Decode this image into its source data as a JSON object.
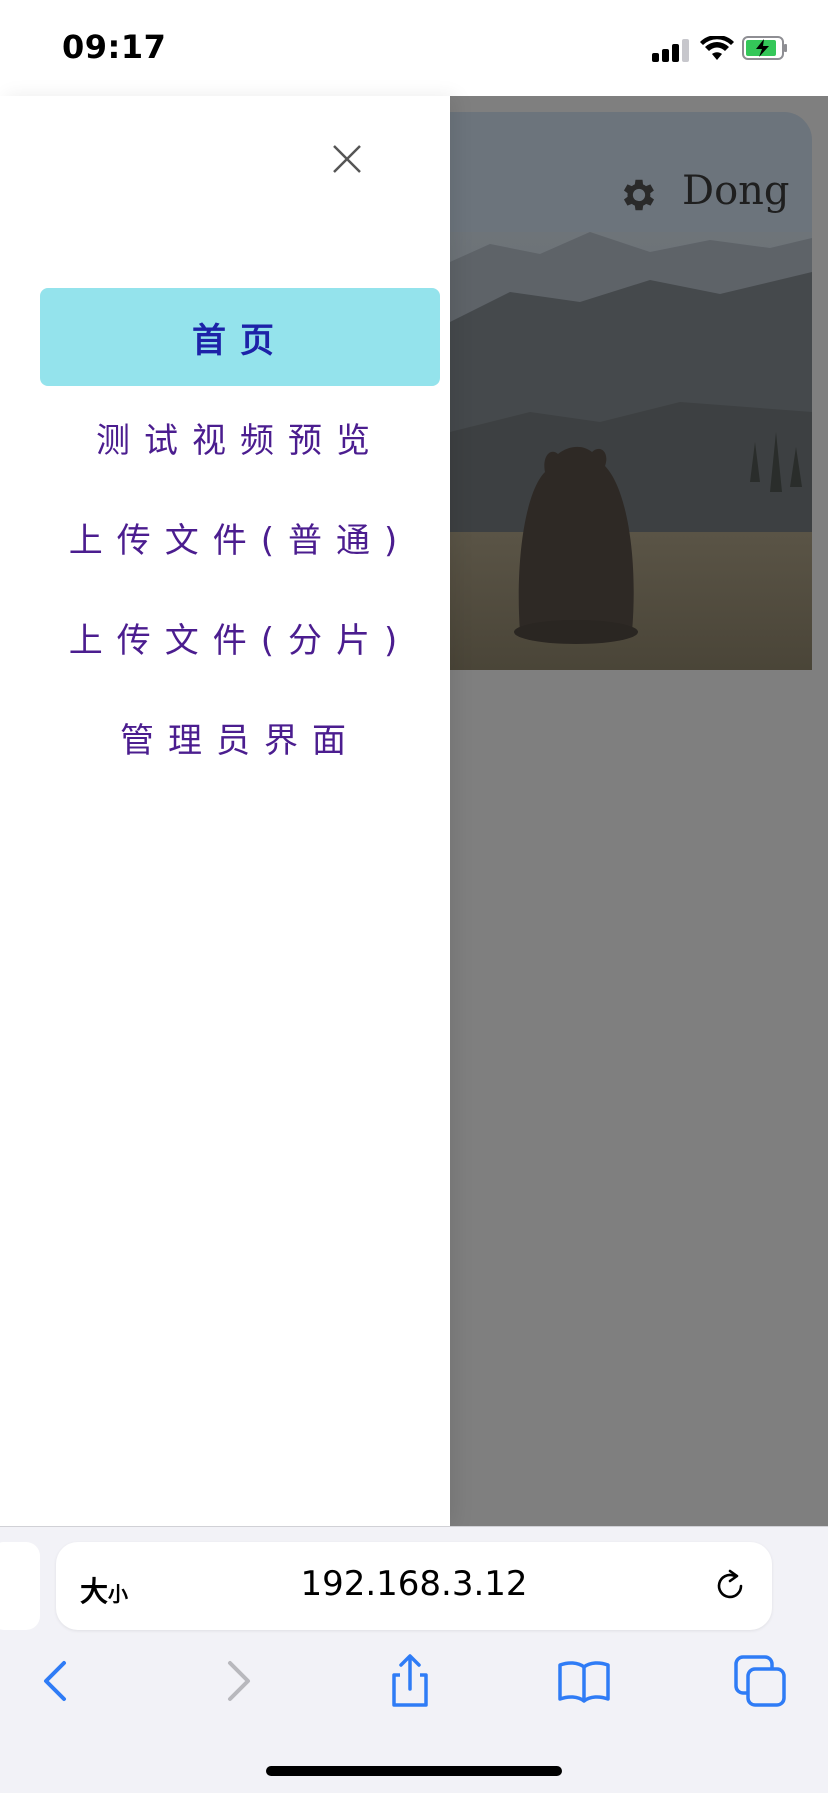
{
  "status_bar": {
    "time": "09:17",
    "battery_state": "charging",
    "icons": [
      "cellular-signal-icon",
      "wifi-icon",
      "battery-charging-icon"
    ]
  },
  "background_page": {
    "user_name": "Dong",
    "settings_icon": "gear-icon",
    "hero_image": "bear-in-mountain-meadow"
  },
  "drawer": {
    "close_icon": "close-icon",
    "menu_items": [
      {
        "label": "首页",
        "active": true
      },
      {
        "label": "测试视频预览",
        "active": false
      },
      {
        "label": "上传文件(普通)",
        "active": false
      },
      {
        "label": "上传文件(分片)",
        "active": false
      },
      {
        "label": "管理员界面",
        "active": false
      }
    ]
  },
  "browser": {
    "text_size_label_large": "大",
    "text_size_label_small": "小",
    "url": "192.168.3.12",
    "toolbar_icons": [
      "back-icon",
      "forward-icon",
      "share-icon",
      "bookmarks-icon",
      "tabs-icon"
    ]
  },
  "colors": {
    "active_menu_bg": "#94e3ec",
    "active_menu_text": "#1d22a8",
    "menu_text": "#4b1d8f",
    "overlay": "#7f7f7f",
    "ios_blue": "#2f7cf6"
  }
}
